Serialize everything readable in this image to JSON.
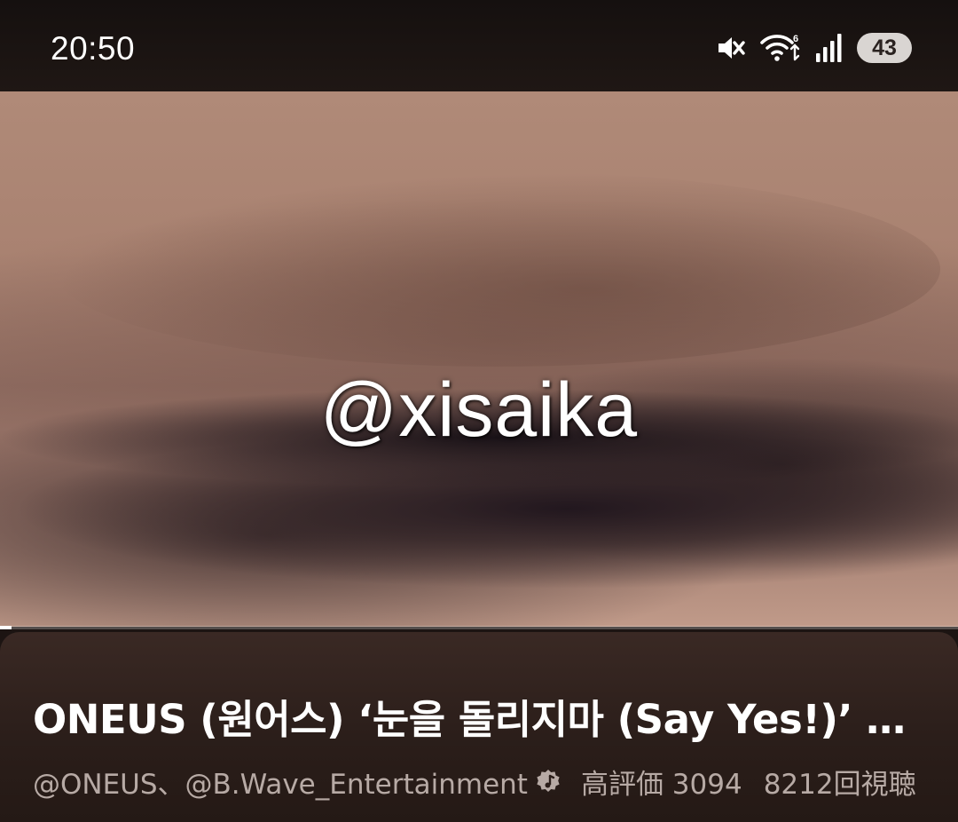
{
  "status_bar": {
    "time": "20:50",
    "battery": "43",
    "icons": [
      "mute-icon",
      "wifi-icon",
      "signal-icon",
      "battery-icon"
    ]
  },
  "video": {
    "watermark": "@xisaika",
    "progress": 0.012
  },
  "info": {
    "title": "ONEUS (원어스) ‘눈을 돌리지마 (Say Yes!)’ Official MV",
    "channels": "@ONEUS、@B.Wave_Entertainment",
    "channel_badge_icon": "music-note-badge-icon",
    "likes": "高評価 3094",
    "views": "8212回視聴"
  },
  "colors": {
    "status_bg": "#15100f",
    "panel_bg": "#2b1e1a",
    "meta_text": "#b7aaa5",
    "battery_pill": "#d9d5d2"
  }
}
